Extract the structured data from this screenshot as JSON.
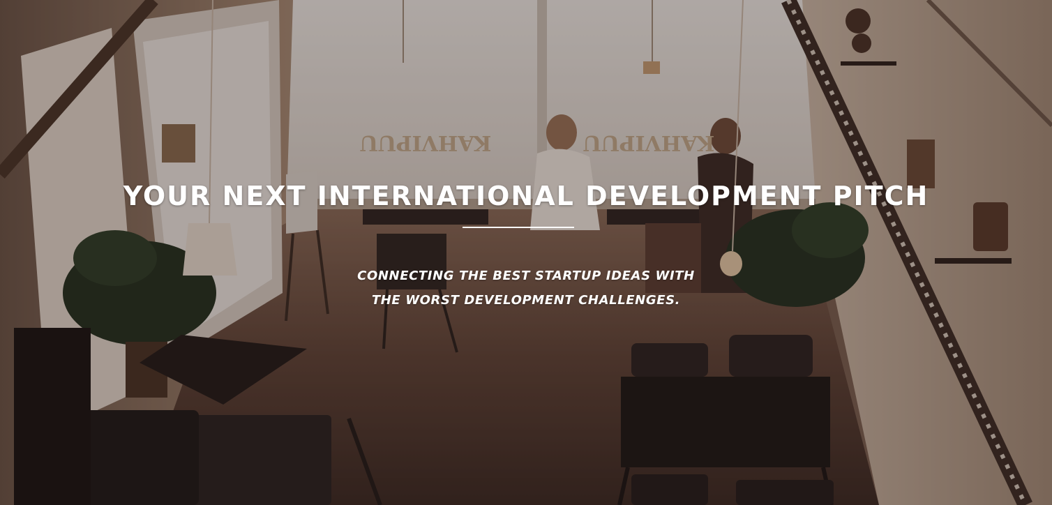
{
  "hero": {
    "title": "YOUR NEXT INTERNATIONAL DEVELOPMENT PITCH",
    "subtitle_line1": "CONNECTING THE BEST STARTUP IDEAS WITH",
    "subtitle_line2": "THE WORST DEVELOPMENT CHALLENGES.",
    "window_lettering_left": "KAHVIPUU",
    "window_lettering_right": "KAHVIPUU"
  },
  "colors": {
    "text": "#ffffff",
    "overlay": "#1c1210",
    "floor": "#5a3f33",
    "window": "#e8e2dc"
  }
}
